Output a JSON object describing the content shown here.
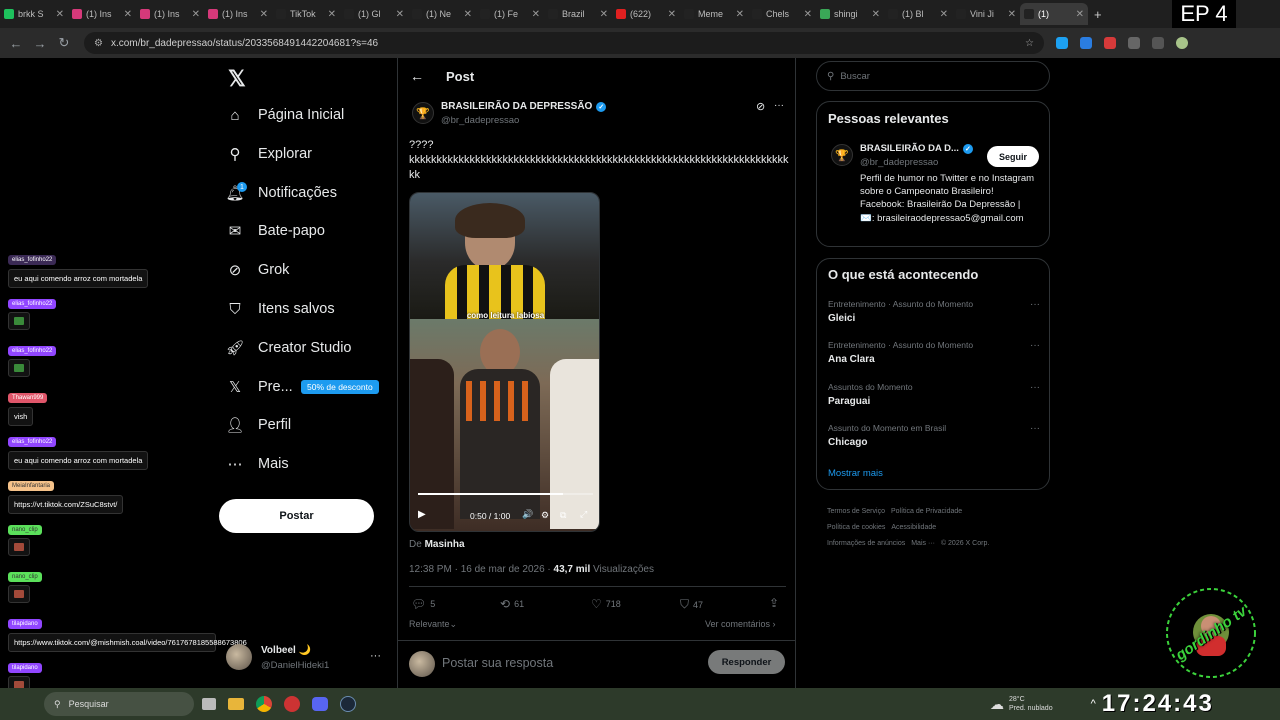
{
  "browser": {
    "tabs": [
      {
        "label": "brkk S",
        "fav": "#1ec15d"
      },
      {
        "label": "(1) Ins",
        "fav": "#d6397a"
      },
      {
        "label": "(1) Ins",
        "fav": "#d6397a"
      },
      {
        "label": "(1) Ins",
        "fav": "#d6397a"
      },
      {
        "label": "TikTok",
        "fav": "#222"
      },
      {
        "label": "(1) Gl",
        "fav": "#222"
      },
      {
        "label": "(1) Ne",
        "fav": "#222"
      },
      {
        "label": "(1) Fe",
        "fav": "#222"
      },
      {
        "label": "Brazil",
        "fav": "#222"
      },
      {
        "label": "(622)",
        "fav": "#e02020"
      },
      {
        "label": "Meme",
        "fav": "#222"
      },
      {
        "label": "Chels",
        "fav": "#222"
      },
      {
        "label": "shingi",
        "fav": "#3aa757"
      },
      {
        "label": "(1) Bl",
        "fav": "#222"
      },
      {
        "label": "Vini Ji",
        "fav": "#222"
      },
      {
        "label": "(1)",
        "fav": "#222"
      }
    ],
    "url": "x.com/br_dadepressao/status/2033568491442204681?s=46",
    "overlay_badge": "EP 4"
  },
  "chat": [
    {
      "user": "elias_fofinho22",
      "color": "#3b2a55",
      "msg": "eu aqui comendo arroz com mortadela",
      "type": "text"
    },
    {
      "user": "elias_fofinho22",
      "color": "#9146ff",
      "msg": "",
      "type": "emote"
    },
    {
      "user": "elias_fofinho22",
      "color": "#9146ff",
      "msg": "",
      "type": "emote"
    },
    {
      "user": "Thawan999",
      "color": "#e0566a",
      "msg": "vish",
      "type": "text"
    },
    {
      "user": "elias_fofinho22",
      "color": "#9146ff",
      "msg": "eu aqui comendo arroz com mortadela",
      "type": "text"
    },
    {
      "user": "MeiaInfantaria",
      "color": "#f5c28a",
      "msg": "https://vt.tiktok.com/ZSuC8stvt/",
      "type": "text"
    },
    {
      "user": "nano_clip",
      "color": "#5be05b",
      "msg": "",
      "type": "emote"
    },
    {
      "user": "nano_clip",
      "color": "#5be05b",
      "msg": "",
      "type": "emote"
    },
    {
      "user": "tilapidano",
      "color": "#9146ff",
      "msg": "https://www.tiktok.com/@mishmish.coal/video/7617678185588673806",
      "type": "text"
    },
    {
      "user": "tilapidano",
      "color": "#9146ff",
      "msg": "",
      "type": "emote"
    },
    {
      "user": "tilapidano",
      "color": "#9146ff",
      "msg": "ta certo",
      "type": "text"
    }
  ],
  "xnav": {
    "items": [
      "Página Inicial",
      "Explorar",
      "Notificações",
      "Bate-papo",
      "Grok",
      "Itens salvos",
      "Creator Studio",
      "Pre...",
      "Perfil",
      "Mais"
    ],
    "premium_badge": "50% de desconto",
    "post_button": "Postar",
    "account_name": "Volbeel 🌙",
    "account_handle": "@DanielHideki1",
    "notif_count": "1"
  },
  "post": {
    "header_title": "Post",
    "author_name": "BRASILEIRÃO DA DEPRESSÃO",
    "author_handle": "@br_dadepressao",
    "text": "????\nkkkkkkkkkkkkkkkkkkkkkkkkkkkkkkkkkkkkkkkkkkkkkkkkkkkkkkkkkkkkkkkkkkkkkkk",
    "video_caption": "como leitura labiosa",
    "video_time": "0:50 / 1:00",
    "video_progress": 0.83,
    "source_prefix": "De",
    "source_name": "Masinha",
    "timestamp": "12:38 PM · 16 de mar de 2026 · ",
    "views_count": "43,7 mil",
    "views_label": " Visualizações",
    "replies": "5",
    "reposts": "61",
    "likes": "718",
    "bookmarks": "47",
    "sort_label": "Relevante",
    "view_quotes": "Ver comentários",
    "reply_placeholder": "Postar sua resposta",
    "reply_button": "Responder"
  },
  "right": {
    "search_placeholder": "Buscar",
    "relevant_title": "Pessoas relevantes",
    "rel_name": "BRASILEIRÃO DA D...",
    "rel_handle": "@br_dadepressao",
    "follow_label": "Seguir",
    "rel_bio": "Perfil de humor no Twitter e no Instagram sobre o Campeonato Brasileiro! Facebook: Brasileirão Da Depressão | ✉️: brasileiraodepressao5@gmail.com",
    "trends_title": "O que está acontecendo",
    "trends": [
      {
        "cat": "Entretenimento · Assunto do Momento",
        "name": "Gleici"
      },
      {
        "cat": "Entretenimento · Assunto do Momento",
        "name": "Ana Clara"
      },
      {
        "cat": "Assuntos do Momento",
        "name": "Paraguai"
      },
      {
        "cat": "Assunto do Momento em Brasil",
        "name": "Chicago"
      }
    ],
    "show_more": "Mostrar mais",
    "footer": [
      "Termos de Serviço",
      "Política de Privacidade",
      "Política de cookies",
      "Acessibilidade",
      "Informações de anúncios",
      "Mais ···",
      "© 2026 X Corp."
    ]
  },
  "taskbar": {
    "search": "Pesquisar",
    "weather_temp": "28°C",
    "weather_desc": "Pred. nublado",
    "clock": "17:24:43"
  },
  "streamer_logo": "gordinho tv gordinho tv"
}
